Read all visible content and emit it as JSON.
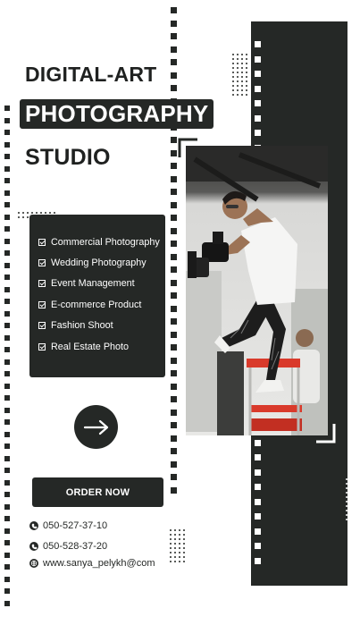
{
  "title": {
    "line1": "DIGITAL-ART",
    "line2": "PHOTOGRAPHY",
    "line3": "STUDIO"
  },
  "services": [
    "Commercial Photography",
    "Wedding Photography",
    "Event Management",
    "E-commerce Product",
    "Fashion Shoot",
    "Real Estate Photo"
  ],
  "cta": {
    "label": "ORDER NOW"
  },
  "contacts": [
    {
      "icon": "phone-icon",
      "text": "050-527-37-10"
    },
    {
      "icon": "phone-icon",
      "text": "050-528-37-20"
    },
    {
      "icon": "globe-icon",
      "text": "www.sanya_pelykh@com"
    }
  ],
  "colors": {
    "dark": "#252826",
    "background": "#ffffff",
    "ladder_red": "#d93a2b"
  }
}
